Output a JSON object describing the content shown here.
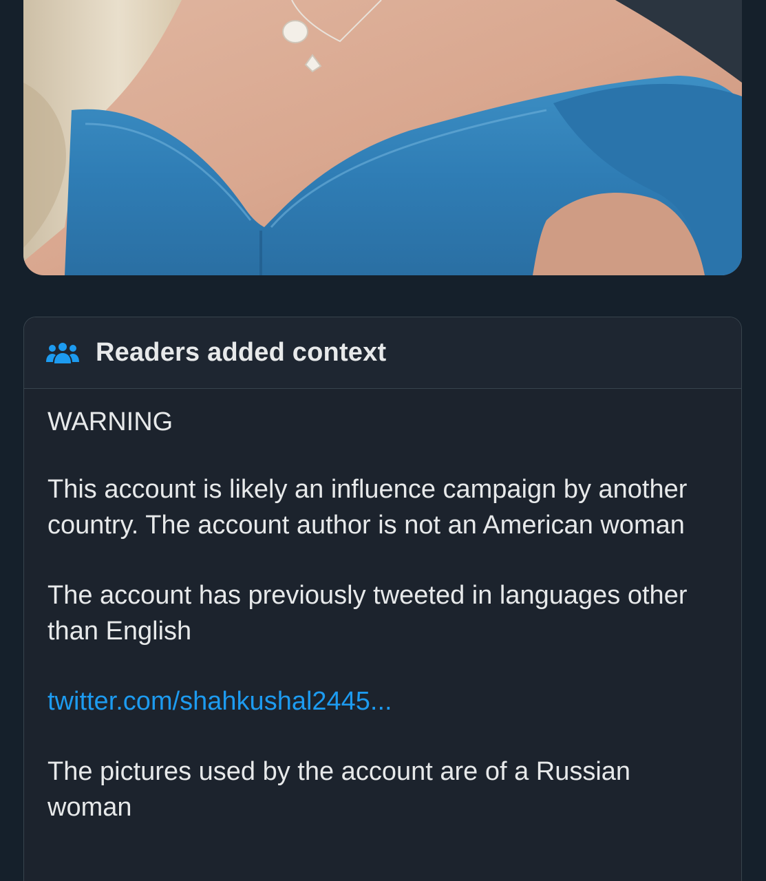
{
  "note": {
    "header_icon": "people-group-icon",
    "title": "Readers added context",
    "warning": "WARNING",
    "paragraphs": [
      "This account is likely an influence campaign by another country. The account author is not an American woman",
      "The account has previously tweeted in languages other than English"
    ],
    "link": "twitter.com/shahkushal2445...",
    "closing": "The pictures used by the account are of a Russian woman"
  },
  "colors": {
    "background": "#15202b",
    "card": "#1c232d",
    "link": "#1d9bf0",
    "icon": "#1d9bf0",
    "text": "#e7e9ea"
  }
}
